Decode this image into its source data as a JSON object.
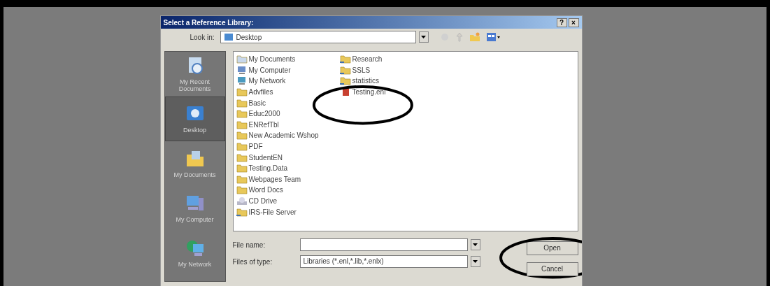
{
  "window": {
    "title": "Select a Reference Library:",
    "title_buttons": [
      "?",
      "×"
    ]
  },
  "look_in": {
    "label": "Look in:",
    "value": "Desktop"
  },
  "places": [
    {
      "label": "My Recent Documents",
      "kind": "recent",
      "selected": false
    },
    {
      "label": "Desktop",
      "kind": "desktop",
      "selected": true
    },
    {
      "label": "My Documents",
      "kind": "documents",
      "selected": false
    },
    {
      "label": "My Computer",
      "kind": "computer",
      "selected": false
    },
    {
      "label": "My Network",
      "kind": "network",
      "selected": false
    }
  ],
  "files": [
    {
      "name": "My Documents",
      "kind": "documents",
      "circled": false
    },
    {
      "name": "My Computer",
      "kind": "computer",
      "circled": false
    },
    {
      "name": "My Network",
      "kind": "network",
      "circled": false
    },
    {
      "name": "Advfiles",
      "kind": "folder",
      "circled": false
    },
    {
      "name": "Basic",
      "kind": "folder",
      "circled": false
    },
    {
      "name": "Educ2000",
      "kind": "folder",
      "circled": false
    },
    {
      "name": "ENRefTbl",
      "kind": "folder",
      "circled": false
    },
    {
      "name": "New Academic Wshop",
      "kind": "folder",
      "circled": false
    },
    {
      "name": "PDF",
      "kind": "folder",
      "circled": false
    },
    {
      "name": "StudentEN",
      "kind": "folder",
      "circled": false
    },
    {
      "name": "Testing.Data",
      "kind": "folder",
      "circled": false
    },
    {
      "name": "Webpages Team",
      "kind": "folder",
      "circled": false
    },
    {
      "name": "Word Docs",
      "kind": "folder",
      "circled": false
    },
    {
      "name": "CD Drive",
      "kind": "cd",
      "circled": false
    },
    {
      "name": "IRS-File Server",
      "kind": "shared",
      "circled": false
    },
    {
      "name": "Research",
      "kind": "shared",
      "circled": false
    },
    {
      "name": "SSLS",
      "kind": "shared",
      "circled": false
    },
    {
      "name": "statistics",
      "kind": "shared",
      "circled": false
    },
    {
      "name": "Testing.enl",
      "kind": "library",
      "circled": true
    }
  ],
  "file_name": {
    "label": "File name:"
  },
  "file_type": {
    "label": "Files of type:",
    "value": "Libraries (*.enl,*.lib,*.enlx)"
  },
  "buttons": [
    {
      "label": "Open",
      "circled": true
    },
    {
      "label": "Cancel",
      "circled": false
    }
  ]
}
